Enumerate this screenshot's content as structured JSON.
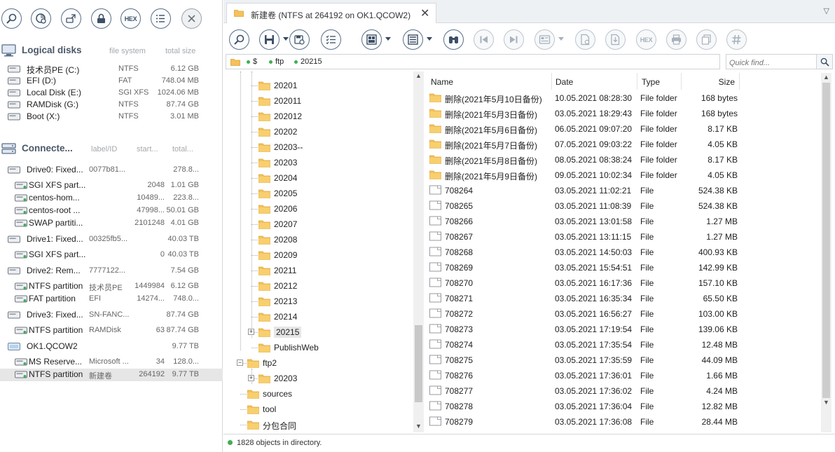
{
  "left_toolbar": [
    {
      "name": "search-icon",
      "glyph": "search"
    },
    {
      "name": "disk-scan-icon",
      "glyph": "scan"
    },
    {
      "name": "connect-icon",
      "glyph": "connect"
    },
    {
      "name": "lock-icon",
      "glyph": "lock"
    },
    {
      "name": "hex-icon",
      "label": "HEX"
    },
    {
      "name": "list-icon",
      "glyph": "list"
    },
    {
      "name": "close-icon",
      "glyph": "close"
    }
  ],
  "logical": {
    "title": "Logical disks",
    "col_fs": "file system",
    "col_size": "total size",
    "items": [
      {
        "name": "技术员PE (C:)",
        "fs": "NTFS",
        "size": "6.12 GB"
      },
      {
        "name": "EFI (D:)",
        "fs": "FAT",
        "size": "748.04 MB"
      },
      {
        "name": "Local Disk (E:)",
        "fs": "SGI XFS",
        "size": "1024.06 MB"
      },
      {
        "name": "RAMDisk (G:)",
        "fs": "NTFS",
        "size": "87.74 GB"
      },
      {
        "name": "Boot (X:)",
        "fs": "NTFS",
        "size": "3.01 MB"
      }
    ]
  },
  "connected": {
    "title": "Connecte...",
    "col_label": "label/ID",
    "col_start": "start...",
    "col_total": "total...",
    "items": [
      {
        "level": 0,
        "kind": "drive",
        "name": "Drive0: Fixed...",
        "label": "0077b81...",
        "start": "",
        "size": "278.8..."
      },
      {
        "level": 1,
        "kind": "part",
        "name": "SGI XFS part...",
        "label": "",
        "start": "2048",
        "size": "1.01 GB"
      },
      {
        "level": 1,
        "kind": "part",
        "name": "centos-hom...",
        "label": "",
        "start": "10489...",
        "size": "223.8..."
      },
      {
        "level": 1,
        "kind": "part",
        "name": "centos-root ...",
        "label": "",
        "start": "47998...",
        "size": "50.01 GB"
      },
      {
        "level": 1,
        "kind": "swap",
        "name": "SWAP partiti...",
        "label": "",
        "start": "2101248",
        "size": "4.01 GB"
      },
      {
        "level": 0,
        "kind": "drive",
        "name": "Drive1: Fixed...",
        "label": "00325fb5...",
        "start": "",
        "size": "40.03 TB"
      },
      {
        "level": 1,
        "kind": "part",
        "name": "SGI XFS part...",
        "label": "",
        "start": "0",
        "size": "40.03 TB"
      },
      {
        "level": 0,
        "kind": "drive",
        "name": "Drive2: Rem...",
        "label": "7777122...",
        "start": "",
        "size": "7.54 GB"
      },
      {
        "level": 1,
        "kind": "part",
        "name": "NTFS partition",
        "label": "技术员PE",
        "start": "1449984",
        "size": "6.12 GB"
      },
      {
        "level": 1,
        "kind": "part",
        "name": "FAT partition",
        "label": "EFI",
        "start": "14274...",
        "size": "748.0..."
      },
      {
        "level": 0,
        "kind": "drive",
        "name": "Drive3: Fixed...",
        "label": "SN-FANC...",
        "start": "",
        "size": "87.74 GB"
      },
      {
        "level": 1,
        "kind": "part",
        "name": "NTFS partition",
        "label": "RAMDisk",
        "start": "63",
        "size": "87.74 GB"
      },
      {
        "level": 0,
        "kind": "image",
        "name": "OK1.QCOW2",
        "label": "",
        "start": "",
        "size": "9.77 TB"
      },
      {
        "level": 1,
        "kind": "part",
        "name": "MS Reserve...",
        "label": "Microsoft ...",
        "start": "34",
        "size": "128.0..."
      },
      {
        "level": 1,
        "kind": "part",
        "name": "NTFS partition",
        "label": "新建卷",
        "start": "264192",
        "size": "9.77 TB",
        "selected": true
      }
    ]
  },
  "tab": {
    "label": "新建卷 (NTFS at 264192 on OK1.QCOW2)",
    "close": "✕",
    "menu": "▽"
  },
  "right_toolbar": [
    {
      "name": "search-icon",
      "dis": false
    },
    {
      "name": "save-icon",
      "dis": false,
      "dd": true
    },
    {
      "name": "save-files-icon",
      "dis": false
    },
    {
      "name": "list-check-icon",
      "dis": false
    },
    {
      "name": "view-mode-icon",
      "dis": false,
      "dd": true
    },
    {
      "name": "details-icon",
      "dis": false,
      "dd": true
    },
    {
      "name": "binoculars-icon",
      "dis": false
    },
    {
      "name": "previous-icon",
      "dis": true
    },
    {
      "name": "next-icon",
      "dis": true
    },
    {
      "name": "preview-icon",
      "dis": true,
      "dd": true
    },
    {
      "name": "file-scan-icon",
      "dis": true
    },
    {
      "name": "file-export-icon",
      "dis": true
    },
    {
      "name": "hex-icon",
      "dis": true,
      "label": "HEX"
    },
    {
      "name": "print-icon",
      "dis": true
    },
    {
      "name": "copy-icon",
      "dis": true
    },
    {
      "name": "hash-icon",
      "dis": true
    }
  ],
  "path": [
    "$",
    "ftp",
    "20215"
  ],
  "quickfind": {
    "placeholder": "Quick find..."
  },
  "tree": [
    {
      "label": "20201",
      "depth": 2
    },
    {
      "label": "202011",
      "depth": 2
    },
    {
      "label": "202012",
      "depth": 2
    },
    {
      "label": "20202",
      "depth": 2
    },
    {
      "label": "20203--",
      "depth": 2
    },
    {
      "label": "20203",
      "depth": 2
    },
    {
      "label": "20204",
      "depth": 2
    },
    {
      "label": "20205",
      "depth": 2
    },
    {
      "label": "20206",
      "depth": 2
    },
    {
      "label": "20207",
      "depth": 2
    },
    {
      "label": "20208",
      "depth": 2
    },
    {
      "label": "20209",
      "depth": 2
    },
    {
      "label": "20211",
      "depth": 2
    },
    {
      "label": "20212",
      "depth": 2
    },
    {
      "label": "20213",
      "depth": 2
    },
    {
      "label": "20214",
      "depth": 2
    },
    {
      "label": "20215",
      "depth": 2,
      "expander": "+",
      "selected": true
    },
    {
      "label": "PublishWeb",
      "depth": 2
    },
    {
      "label": "ftp2",
      "depth": 1,
      "expander": "−"
    },
    {
      "label": "20203",
      "depth": 2,
      "expander": "+"
    },
    {
      "label": "sources",
      "depth": 1
    },
    {
      "label": "tool",
      "depth": 1
    },
    {
      "label": "分包合同",
      "depth": 1
    }
  ],
  "list": {
    "headers": {
      "name": "Name",
      "date": "Date",
      "type": "Type",
      "size": "Size"
    },
    "rows": [
      {
        "icon": "folder",
        "name": "删除(2021年5月10日备份)",
        "date": "10.05.2021 08:28:30",
        "type": "File folder",
        "size": "168 bytes"
      },
      {
        "icon": "folder",
        "name": "删除(2021年5月3日备份)",
        "date": "03.05.2021 18:29:43",
        "type": "File folder",
        "size": "168 bytes"
      },
      {
        "icon": "folder",
        "name": "删除(2021年5月6日备份)",
        "date": "06.05.2021 09:07:20",
        "type": "File folder",
        "size": "8.17 KB"
      },
      {
        "icon": "folder",
        "name": "删除(2021年5月7日备份)",
        "date": "07.05.2021 09:03:22",
        "type": "File folder",
        "size": "4.05 KB"
      },
      {
        "icon": "folder",
        "name": "删除(2021年5月8日备份)",
        "date": "08.05.2021 08:38:24",
        "type": "File folder",
        "size": "8.17 KB"
      },
      {
        "icon": "folder",
        "name": "删除(2021年5月9日备份)",
        "date": "09.05.2021 10:02:34",
        "type": "File folder",
        "size": "4.05 KB"
      },
      {
        "icon": "file",
        "name": "708264",
        "date": "03.05.2021 11:02:21",
        "type": "File",
        "size": "524.38 KB"
      },
      {
        "icon": "file",
        "name": "708265",
        "date": "03.05.2021 11:08:39",
        "type": "File",
        "size": "524.38 KB"
      },
      {
        "icon": "file",
        "name": "708266",
        "date": "03.05.2021 13:01:58",
        "type": "File",
        "size": "1.27 MB"
      },
      {
        "icon": "file",
        "name": "708267",
        "date": "03.05.2021 13:11:15",
        "type": "File",
        "size": "1.27 MB"
      },
      {
        "icon": "file",
        "name": "708268",
        "date": "03.05.2021 14:50:03",
        "type": "File",
        "size": "400.93 KB"
      },
      {
        "icon": "file",
        "name": "708269",
        "date": "03.05.2021 15:54:51",
        "type": "File",
        "size": "142.99 KB"
      },
      {
        "icon": "file",
        "name": "708270",
        "date": "03.05.2021 16:17:36",
        "type": "File",
        "size": "157.10 KB"
      },
      {
        "icon": "file",
        "name": "708271",
        "date": "03.05.2021 16:35:34",
        "type": "File",
        "size": "65.50 KB"
      },
      {
        "icon": "file",
        "name": "708272",
        "date": "03.05.2021 16:56:27",
        "type": "File",
        "size": "103.00 KB"
      },
      {
        "icon": "file",
        "name": "708273",
        "date": "03.05.2021 17:19:54",
        "type": "File",
        "size": "139.06 KB"
      },
      {
        "icon": "file",
        "name": "708274",
        "date": "03.05.2021 17:35:54",
        "type": "File",
        "size": "12.48 MB"
      },
      {
        "icon": "file",
        "name": "708275",
        "date": "03.05.2021 17:35:59",
        "type": "File",
        "size": "44.09 MB"
      },
      {
        "icon": "file",
        "name": "708276",
        "date": "03.05.2021 17:36:01",
        "type": "File",
        "size": "1.66 MB"
      },
      {
        "icon": "file",
        "name": "708277",
        "date": "03.05.2021 17:36:02",
        "type": "File",
        "size": "4.24 MB"
      },
      {
        "icon": "file",
        "name": "708278",
        "date": "03.05.2021 17:36:04",
        "type": "File",
        "size": "12.82 MB"
      },
      {
        "icon": "file",
        "name": "708279",
        "date": "03.05.2021 17:36:08",
        "type": "File",
        "size": "28.44 MB"
      }
    ]
  },
  "status": {
    "text": "1828 objects in directory."
  },
  "colors": {
    "accent": "#3c4f66",
    "folder": "#f5c15a",
    "status_ok": "#3fae56",
    "selection": "#e6e6e6"
  }
}
